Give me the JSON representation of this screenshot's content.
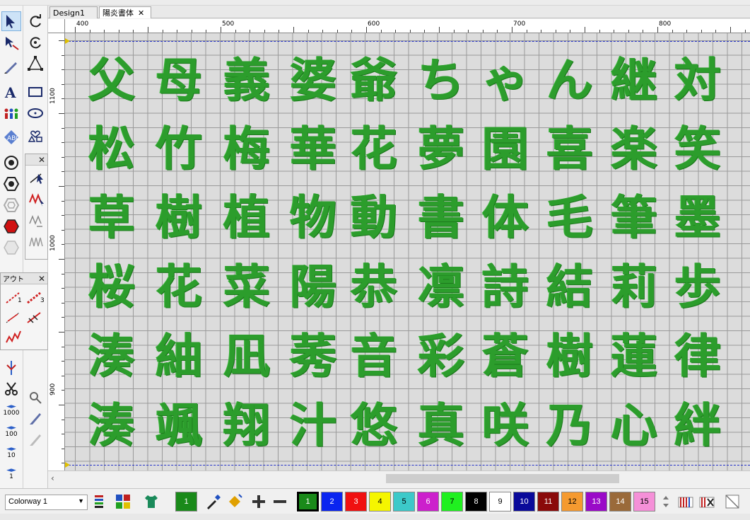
{
  "tabs": [
    {
      "label": "Design1",
      "active": false
    },
    {
      "label": "陽炎書体",
      "active": true
    }
  ],
  "ruler_h_labels": [
    "400",
    "500",
    "600",
    "700",
    "800"
  ],
  "ruler_v_labels": [
    "1100",
    "1000",
    "900"
  ],
  "canvas": {
    "glyph_color": "#2c9d2c",
    "grid_color": "#9a9a9a",
    "rows": [
      [
        "父",
        "母",
        "義",
        "婆",
        "爺",
        "ち",
        "ゃ",
        "ん",
        "継",
        "対"
      ],
      [
        "松",
        "竹",
        "梅",
        "華",
        "花",
        "夢",
        "園",
        "喜",
        "楽",
        "笑"
      ],
      [
        "草",
        "樹",
        "植",
        "物",
        "動",
        "書",
        "体",
        "毛",
        "筆",
        "墨"
      ],
      [
        "桜",
        "花",
        "菜",
        "陽",
        "恭",
        "凛",
        "詩",
        "結",
        "莉",
        "歩"
      ],
      [
        "湊",
        "紬",
        "凪",
        "莠",
        "音",
        "彩",
        "蒼",
        "樹",
        "蓮",
        "律"
      ],
      [
        "湊",
        "颯",
        "翔",
        "汁",
        "悠",
        "真",
        "咲",
        "乃",
        "心",
        "絆"
      ]
    ]
  },
  "left_panels": {
    "outline_panel_title": "アウト"
  },
  "left_tool_numbers": [
    "1",
    "3",
    "1000",
    "100",
    "10",
    "1"
  ],
  "bottom": {
    "colorway_label": "Colorway 1",
    "current_color_number": "1",
    "palette": [
      {
        "n": "1",
        "color": "#1a8a1a",
        "text": "#ffffff"
      },
      {
        "n": "2",
        "color": "#0a25f0",
        "text": "#ffffff"
      },
      {
        "n": "3",
        "color": "#f01010",
        "text": "#ffffff"
      },
      {
        "n": "4",
        "color": "#f5f500",
        "text": "#000000"
      },
      {
        "n": "5",
        "color": "#3cc9c9",
        "text": "#000000"
      },
      {
        "n": "6",
        "color": "#cc20cc",
        "text": "#ffffff"
      },
      {
        "n": "7",
        "color": "#20f020",
        "text": "#000000"
      },
      {
        "n": "8",
        "color": "#000000",
        "text": "#ffffff"
      },
      {
        "n": "9",
        "color": "#ffffff",
        "text": "#000000"
      },
      {
        "n": "10",
        "color": "#0a0a9a",
        "text": "#ffffff"
      },
      {
        "n": "11",
        "color": "#8a0a0a",
        "text": "#ffffff"
      },
      {
        "n": "12",
        "color": "#f59a30",
        "text": "#000000"
      },
      {
        "n": "13",
        "color": "#9a0ac8",
        "text": "#ffffff"
      },
      {
        "n": "14",
        "color": "#9a6a3a",
        "text": "#ffffff"
      },
      {
        "n": "15",
        "color": "#f590d8",
        "text": "#000000"
      }
    ]
  }
}
